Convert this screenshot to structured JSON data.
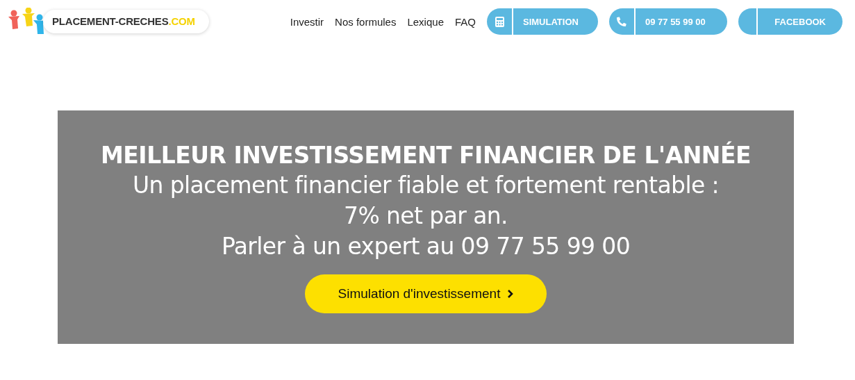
{
  "logo": {
    "name": "PLACEMENT-CRECHES",
    "suffix": ".COM"
  },
  "nav": [
    {
      "label": "Investir"
    },
    {
      "label": "Nos formules"
    },
    {
      "label": "Lexique"
    },
    {
      "label": "FAQ"
    }
  ],
  "actions": [
    {
      "label": "SIMULATION",
      "kind": "calculator"
    },
    {
      "label": "09 77 55 99 00",
      "kind": "phone"
    },
    {
      "label": "FACEBOOK",
      "kind": "blank"
    }
  ],
  "hero": {
    "title": "MEILLEUR INVESTISSEMENT FINANCIER DE L'ANNÉE",
    "lines": [
      "Un placement financier fiable et fortement rentable :",
      "7% net par an.",
      "Parler à un expert au 09 77 55 99 00"
    ],
    "button": "Simulation d'investissement"
  }
}
